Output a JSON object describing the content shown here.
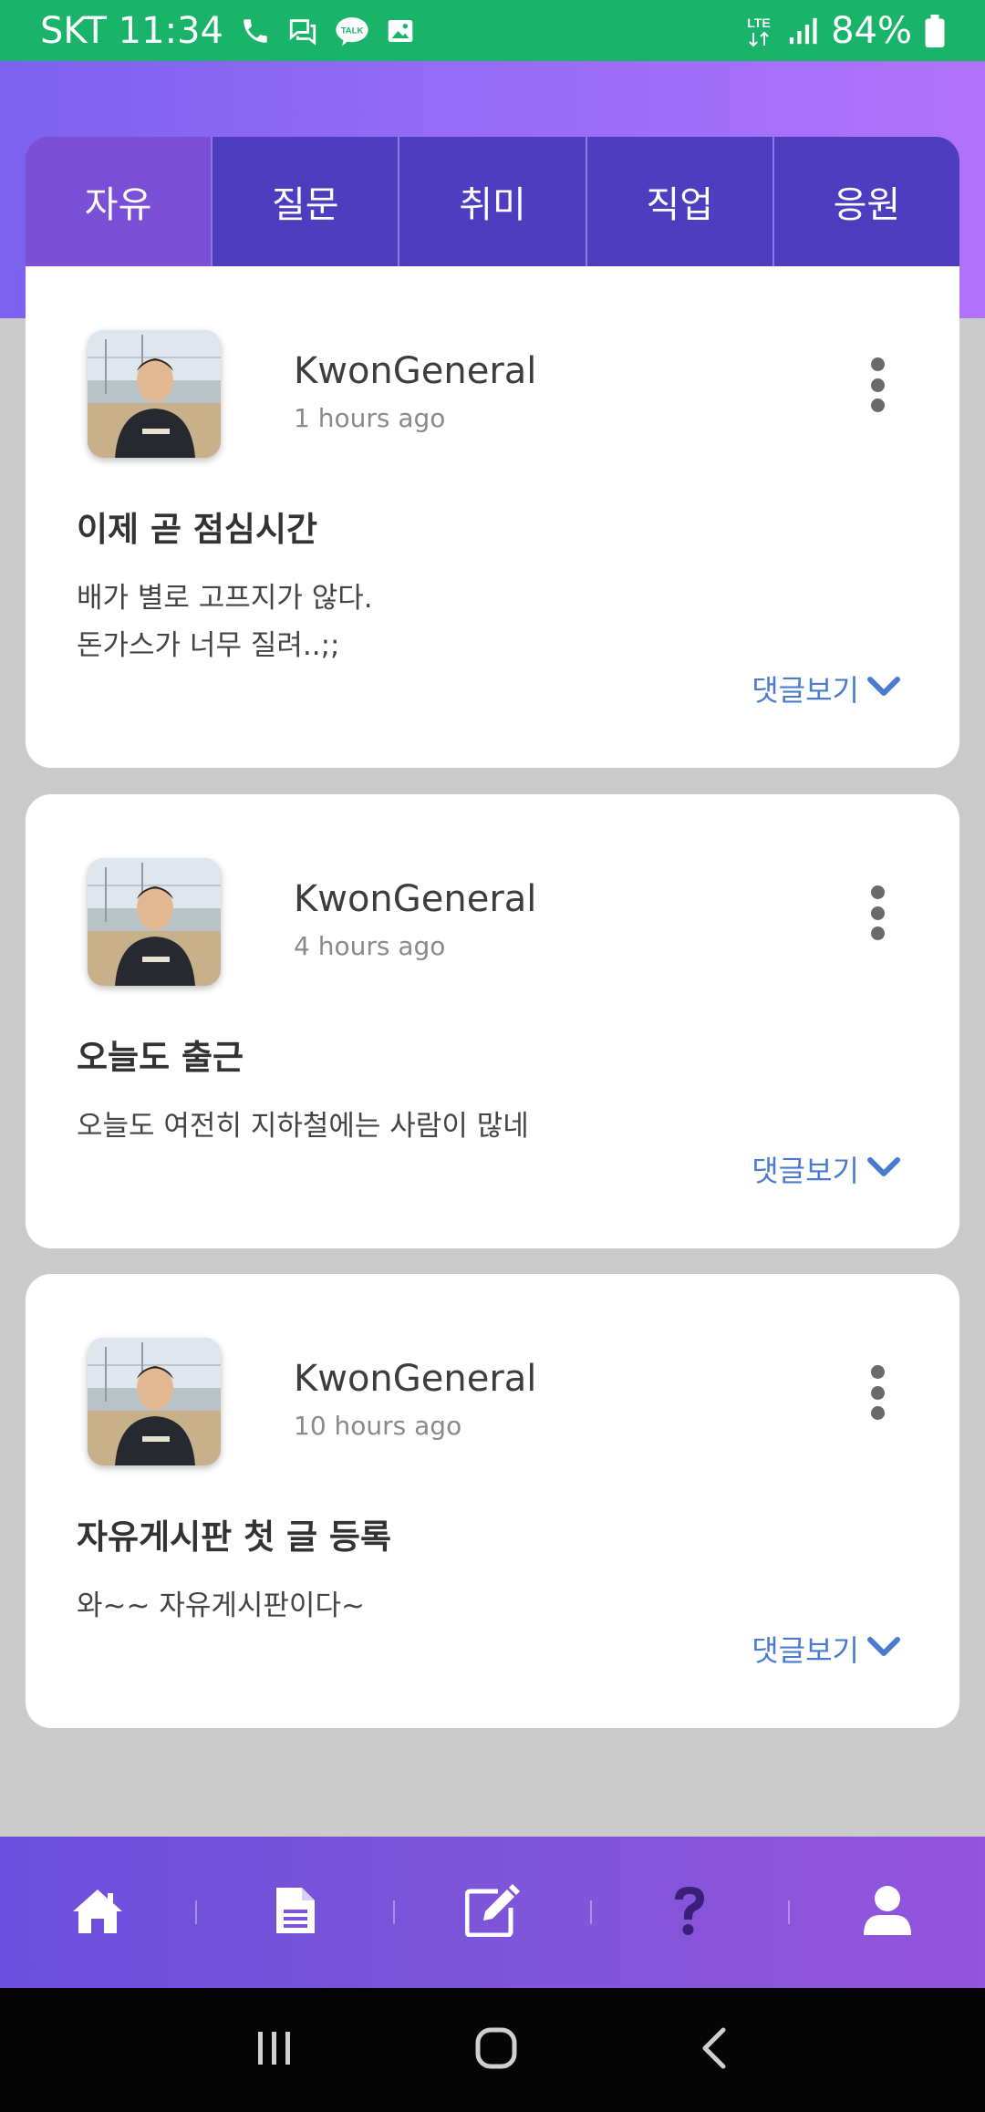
{
  "status": {
    "carrier_time": "SKT 11:34",
    "lte": "LTE",
    "battery": "84%"
  },
  "tabs": [
    {
      "label": "자유",
      "active": true
    },
    {
      "label": "질문",
      "active": false
    },
    {
      "label": "취미",
      "active": false
    },
    {
      "label": "직업",
      "active": false
    },
    {
      "label": "응원",
      "active": false
    }
  ],
  "posts": [
    {
      "author": "KwonGeneral",
      "time": "1 hours ago",
      "title": "이제 곧 점심시간",
      "body_line1": "배가 별로 고프지가 않다.",
      "body_line2": "돈가스가 너무 질려..;;",
      "comment_label": "댓글보기"
    },
    {
      "author": "KwonGeneral",
      "time": "4 hours ago",
      "title": "오늘도 출근",
      "body_line1": "오늘도 여전히 지하철에는 사람이 많네",
      "comment_label": "댓글보기"
    },
    {
      "author": "KwonGeneral",
      "time": "10 hours ago",
      "title": "자유게시판 첫 글 등록",
      "body_line1": "와~~ 자유게시판이다~",
      "comment_label": "댓글보기"
    }
  ],
  "bottom_nav": [
    "home-icon",
    "document-icon",
    "edit-icon",
    "question-icon",
    "user-icon"
  ],
  "colors": {
    "status_bar": "#19b36a",
    "tab_bar": "#4f3dc0",
    "tab_active": "#7b4fd6",
    "accent_link": "#4a7bd0",
    "question_icon": "#3a1f7a"
  }
}
